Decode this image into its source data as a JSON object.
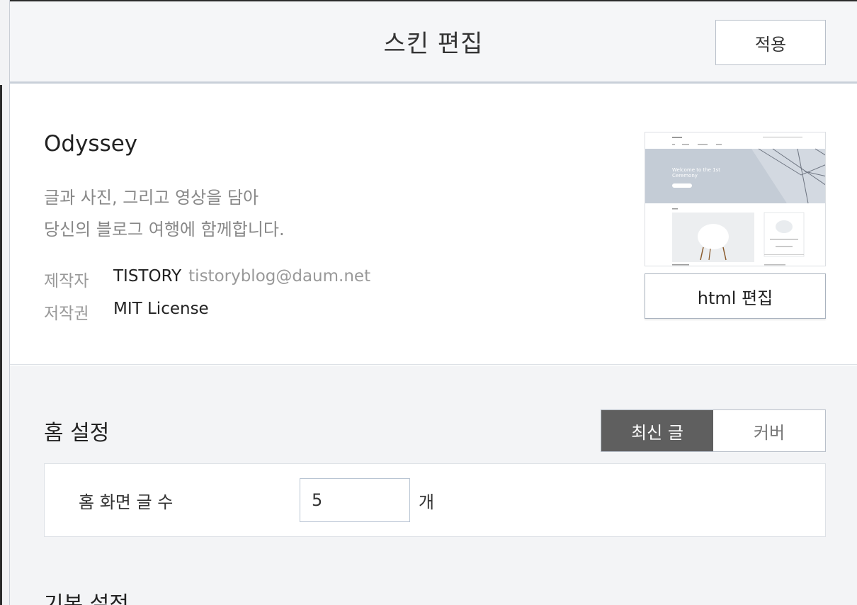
{
  "header": {
    "title": "스킨 편집",
    "apply_label": "적용"
  },
  "skin": {
    "name": "Odyssey",
    "description_line1": "글과 사진, 그리고 영상을 담아",
    "description_line2": "당신의 블로그 여행에 함께합니다.",
    "author_key": "제작자",
    "author_name": "TISTORY",
    "author_email": "tistoryblog@daum.net",
    "license_key": "저작권",
    "license_value": "MIT License",
    "html_edit_label": "html 편집",
    "thumbnail": {
      "hero_text_1": "Welcome to the 1st",
      "hero_text_2": "Ceremony"
    }
  },
  "home_settings": {
    "title": "홈 설정",
    "toggle_options": [
      "최신 글",
      "커버"
    ],
    "selected": "최신 글",
    "post_count_label": "홈 화면 글 수",
    "post_count_value": "5",
    "post_count_unit": "개"
  },
  "basic_settings": {
    "title": "기본 설정"
  },
  "colors": {
    "header_bg": "#f5f6f8",
    "toggle_active": "#5f5f5f",
    "lower_bg": "#f3f4f6"
  }
}
